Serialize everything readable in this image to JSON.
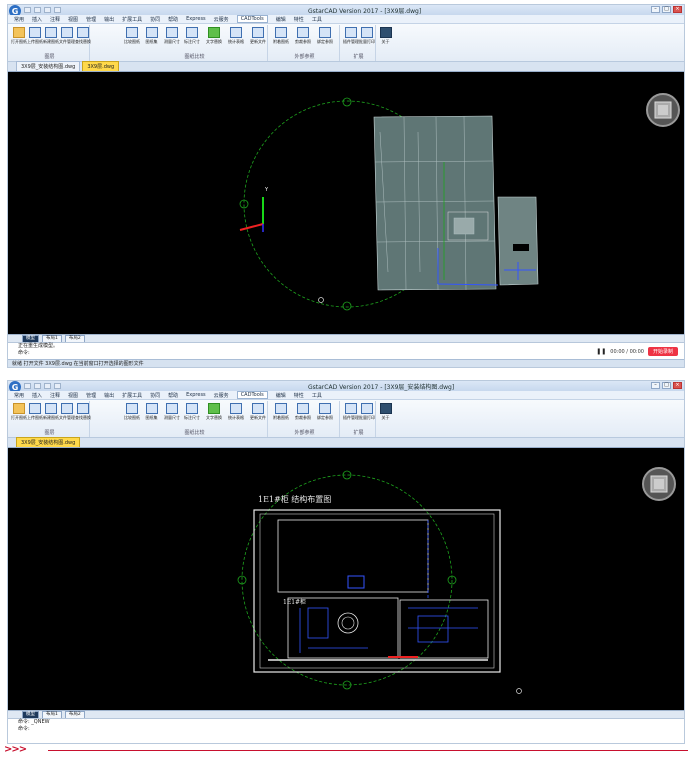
{
  "top": {
    "title": "GstarCAD Version 2017 - [3X9层.dwg]",
    "menu": [
      "常用",
      "插入",
      "注释",
      "视图",
      "管理",
      "输出",
      "扩展工具",
      "协同",
      "帮助",
      "Express",
      "云服务",
      "CADTools",
      "编辑",
      "特性",
      "工具"
    ],
    "ribbon_groups": [
      {
        "label": "图层",
        "buttons": [
          "打开图纸",
          "上传图纸",
          "新建图纸",
          "文件管理",
          "查找替换"
        ]
      },
      {
        "label": "图纸比较",
        "buttons": [
          "比较图纸",
          "图纸集",
          "测量尺寸",
          "标注尺寸",
          "文字替换",
          "统计表格",
          "更新文件"
        ]
      },
      {
        "label": "外部参照",
        "buttons": [
          "附着图纸",
          "剪裁参照",
          "绑定参照"
        ]
      },
      {
        "label": "扩展",
        "buttons": [
          "插件管理",
          "批量打印"
        ]
      },
      {
        "label": "",
        "buttons": [
          "关于"
        ]
      }
    ],
    "doc_tabs": [
      "3X9层_安装结构图.dwg",
      "3X9层.dwg"
    ],
    "layout_tabs": [
      "模型",
      "布局1",
      "布局2"
    ],
    "cmd_lines": [
      "正在重生成模型。",
      "命令:"
    ],
    "timer": "00:00 / 00:00",
    "record_label": "开始录制",
    "status": "就绪 打开文件 3X9层.dwg  在当前窗口打开选择的图形文件"
  },
  "bottom": {
    "title": "GstarCAD Version 2017 - [3X9层_安装结构图.dwg]",
    "menu": [
      "常用",
      "插入",
      "注释",
      "视图",
      "管理",
      "输出",
      "扩展工具",
      "协同",
      "帮助",
      "Express",
      "云服务",
      "CADTools",
      "编辑",
      "特性",
      "工具"
    ],
    "ribbon_groups": [
      {
        "label": "图层",
        "buttons": [
          "打开图纸",
          "上传图纸",
          "新建图纸",
          "文件管理",
          "查找替换"
        ]
      },
      {
        "label": "图纸比较",
        "buttons": [
          "比较图纸",
          "图纸集",
          "测量尺寸",
          "标注尺寸",
          "文字替换",
          "统计表格",
          "更新文件"
        ]
      },
      {
        "label": "外部参照",
        "buttons": [
          "附着图纸",
          "剪裁参照",
          "绑定参照"
        ]
      },
      {
        "label": "扩展",
        "buttons": [
          "插件管理",
          "批量打印"
        ]
      },
      {
        "label": "",
        "buttons": [
          "关于"
        ]
      }
    ],
    "doc_tabs": [
      "3X9层_安装结构图.dwg"
    ],
    "drawing_label": "1E1#柜 结构布置图",
    "layout_tabs": [
      "模型",
      "布局1",
      "布局2"
    ],
    "cmd_lines": [
      "命令: _QNEW",
      "命令:"
    ]
  },
  "divider": {
    "arrows": ">>>"
  },
  "colors": {
    "accent": "#c8102e",
    "canvas": "#000000",
    "ribbon": "#e4ecf6",
    "record": "#e34"
  }
}
